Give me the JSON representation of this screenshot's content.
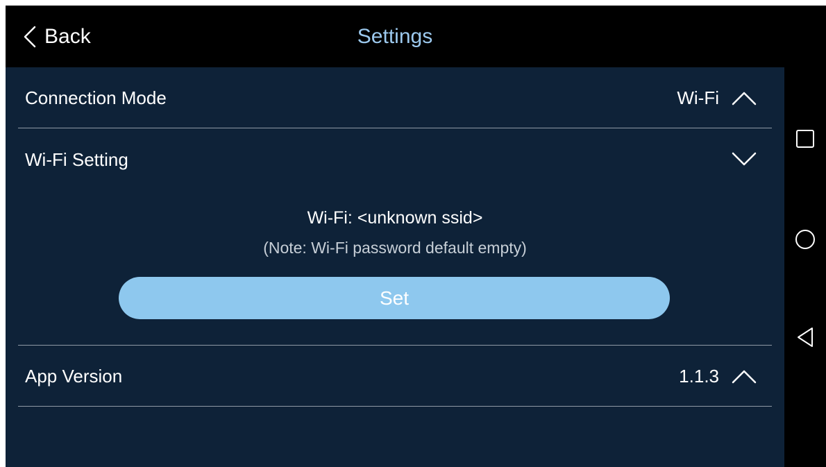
{
  "header": {
    "back_label": "Back",
    "title": "Settings"
  },
  "settings": {
    "connection_mode": {
      "label": "Connection Mode",
      "value": "Wi-Fi",
      "chevron": "chevron-up-icon"
    },
    "wifi_setting": {
      "label": "Wi-Fi Setting",
      "chevron": "chevron-down-icon",
      "ssid_text": "Wi-Fi: <unknown ssid>",
      "note_text": "(Note: Wi-Fi password default empty)",
      "set_label": "Set"
    },
    "app_version": {
      "label": "App Version",
      "value": "1.1.3",
      "chevron": "chevron-up-icon"
    }
  },
  "navbar": {
    "icons": [
      "recents-square-icon",
      "home-circle-icon",
      "back-triangle-icon"
    ]
  },
  "colors": {
    "background": "#0e2238",
    "header": "#000000",
    "title": "#9cc9ee",
    "button": "#8ec8ee",
    "divider": "#8f9aa6"
  }
}
